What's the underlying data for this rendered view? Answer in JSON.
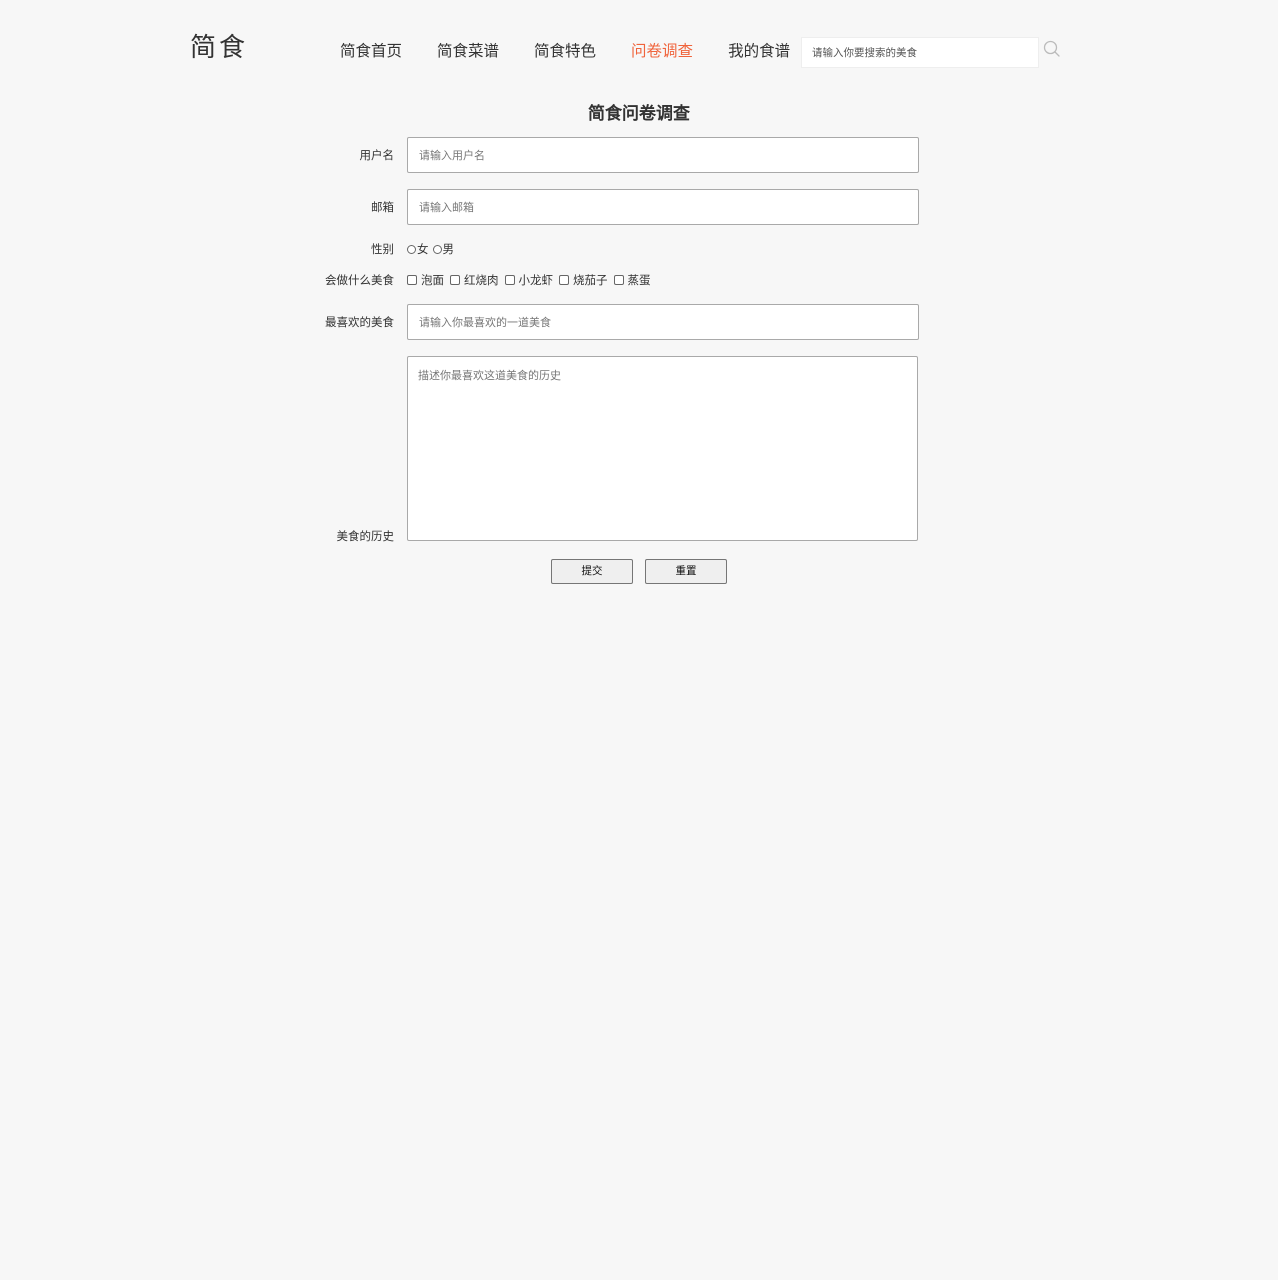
{
  "header": {
    "logo": "简食",
    "nav": [
      {
        "label": "简食首页",
        "active": false
      },
      {
        "label": "简食菜谱",
        "active": false
      },
      {
        "label": "简食特色",
        "active": false
      },
      {
        "label": "问卷调查",
        "active": true
      },
      {
        "label": "我的食谱",
        "active": false
      }
    ],
    "search": {
      "placeholder": "请输入你要搜索的美食",
      "value": ""
    },
    "search_icon": "search-icon"
  },
  "form": {
    "title": "简食问卷调查",
    "username": {
      "label": "用户名",
      "placeholder": "请输入用户名",
      "value": ""
    },
    "email": {
      "label": "邮箱",
      "placeholder": "请输入邮箱",
      "value": ""
    },
    "gender": {
      "label": "性别",
      "options": [
        "女",
        "男"
      ],
      "selected": null
    },
    "skills": {
      "label": "会做什么美食",
      "options": [
        "泡面",
        "红烧肉",
        "小龙虾",
        "烧茄子",
        "蒸蛋"
      ],
      "checked": []
    },
    "favorite": {
      "label": "最喜欢的美食",
      "placeholder": "请输入你最喜欢的一道美食",
      "value": ""
    },
    "history": {
      "label": "美食的历史",
      "placeholder": "描述你最喜欢这道美食的历史",
      "value": ""
    },
    "submit_label": "提交",
    "reset_label": "重置"
  },
  "colors": {
    "accent": "#f0643c",
    "background": "#f7f7f7",
    "text": "#333333"
  }
}
